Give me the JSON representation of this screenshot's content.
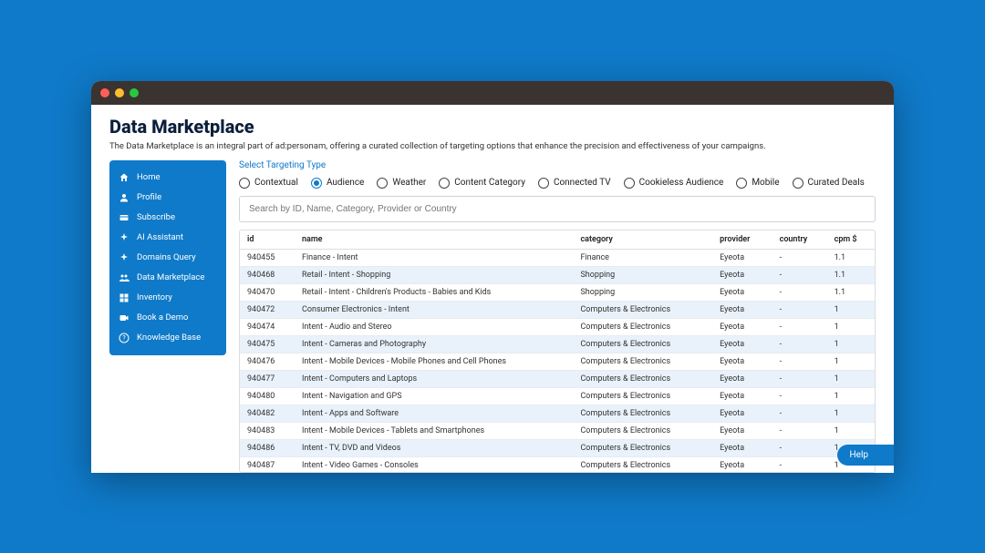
{
  "page": {
    "title": "Data Marketplace",
    "description": "The Data Marketplace is an integral part of ad:personam, offering a curated collection of targeting options that enhance the precision and effectiveness of your campaigns."
  },
  "sidebar": {
    "items": [
      {
        "label": "Home",
        "icon": "home"
      },
      {
        "label": "Profile",
        "icon": "person"
      },
      {
        "label": "Subscribe",
        "icon": "card"
      },
      {
        "label": "AI Assistant",
        "icon": "sparkle"
      },
      {
        "label": "Domains Query",
        "icon": "sparkle"
      },
      {
        "label": "Data Marketplace",
        "icon": "people"
      },
      {
        "label": "Inventory",
        "icon": "grid"
      },
      {
        "label": "Book a Demo",
        "icon": "video"
      },
      {
        "label": "Knowledge Base",
        "icon": "help"
      }
    ]
  },
  "targeting": {
    "label": "Select Targeting Type",
    "options": [
      {
        "label": "Contextual",
        "selected": false
      },
      {
        "label": "Audience",
        "selected": true
      },
      {
        "label": "Weather",
        "selected": false
      },
      {
        "label": "Content Category",
        "selected": false
      },
      {
        "label": "Connected TV",
        "selected": false
      },
      {
        "label": "Cookieless Audience",
        "selected": false
      },
      {
        "label": "Mobile",
        "selected": false
      },
      {
        "label": "Curated Deals",
        "selected": false
      }
    ]
  },
  "search": {
    "placeholder": "Search by ID, Name, Category, Provider or Country"
  },
  "table": {
    "headers": {
      "id": "id",
      "name": "name",
      "category": "category",
      "provider": "provider",
      "country": "country",
      "cpm": "cpm $"
    },
    "rows": [
      {
        "id": "940455",
        "name": "Finance - Intent",
        "category": "Finance",
        "provider": "Eyeota",
        "country": "-",
        "cpm": "1.1",
        "hl": false
      },
      {
        "id": "940468",
        "name": "Retail - Intent - Shopping",
        "category": "Shopping",
        "provider": "Eyeota",
        "country": "-",
        "cpm": "1.1",
        "hl": true
      },
      {
        "id": "940470",
        "name": "Retail - Intent - Children's Products - Babies and Kids",
        "category": "Shopping",
        "provider": "Eyeota",
        "country": "-",
        "cpm": "1.1",
        "hl": false
      },
      {
        "id": "940472",
        "name": "Consumer Electronics - Intent",
        "category": "Computers & Electronics",
        "provider": "Eyeota",
        "country": "-",
        "cpm": "1",
        "hl": true
      },
      {
        "id": "940474",
        "name": "Intent - Audio and Stereo",
        "category": "Computers & Electronics",
        "provider": "Eyeota",
        "country": "-",
        "cpm": "1",
        "hl": false
      },
      {
        "id": "940475",
        "name": "Intent - Cameras and Photography",
        "category": "Computers & Electronics",
        "provider": "Eyeota",
        "country": "-",
        "cpm": "1",
        "hl": true
      },
      {
        "id": "940476",
        "name": "Intent - Mobile Devices - Mobile Phones and Cell Phones",
        "category": "Computers & Electronics",
        "provider": "Eyeota",
        "country": "-",
        "cpm": "1",
        "hl": false
      },
      {
        "id": "940477",
        "name": "Intent - Computers and Laptops",
        "category": "Computers & Electronics",
        "provider": "Eyeota",
        "country": "-",
        "cpm": "1",
        "hl": true
      },
      {
        "id": "940480",
        "name": "Intent - Navigation and GPS",
        "category": "Computers & Electronics",
        "provider": "Eyeota",
        "country": "-",
        "cpm": "1",
        "hl": false
      },
      {
        "id": "940482",
        "name": "Intent - Apps and Software",
        "category": "Computers & Electronics",
        "provider": "Eyeota",
        "country": "-",
        "cpm": "1",
        "hl": true
      },
      {
        "id": "940483",
        "name": "Intent - Mobile Devices - Tablets and Smartphones",
        "category": "Computers & Electronics",
        "provider": "Eyeota",
        "country": "-",
        "cpm": "1",
        "hl": false
      },
      {
        "id": "940486",
        "name": "Intent - TV, DVD and Videos",
        "category": "Computers & Electronics",
        "provider": "Eyeota",
        "country": "-",
        "cpm": "1",
        "hl": true
      },
      {
        "id": "940487",
        "name": "Intent - Video Games - Consoles",
        "category": "Computers & Electronics",
        "provider": "Eyeota",
        "country": "-",
        "cpm": "1",
        "hl": false
      }
    ]
  },
  "help": {
    "label": "Help"
  }
}
